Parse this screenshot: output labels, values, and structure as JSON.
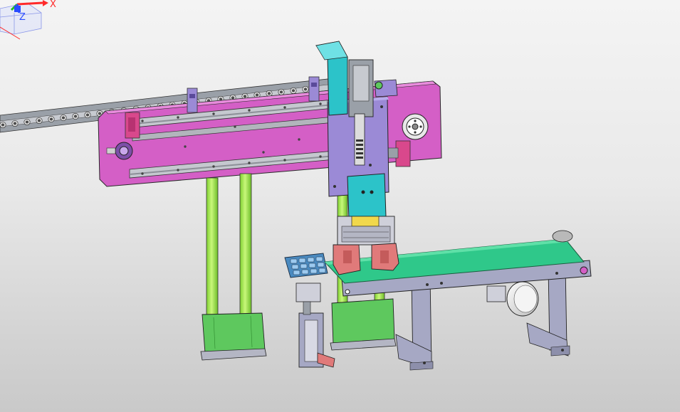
{
  "viewport": {
    "background_top": "#f4f4f4",
    "background_bottom": "#c9c9c9"
  },
  "triad": {
    "x_label": "X",
    "z_label": "Z",
    "x_color": "#ff2a2a",
    "y_color": "#22bb22",
    "z_color": "#2a4cff"
  },
  "model": {
    "parts": [
      "drag-chain",
      "gantry-beam-plate",
      "linear-rails",
      "carriage-plate",
      "vertical-actuator",
      "gripper-head",
      "support-columns",
      "column-bases",
      "tray-stand",
      "belt-conveyor",
      "conveyor-motor"
    ],
    "colors": {
      "beam": "#d45fc6",
      "carriage": "#9b8ad6",
      "actuator": "#2cc3c9",
      "columns": "#9be84a",
      "bases": "#5ec85e",
      "gripper_jaws": "#e07a7a",
      "tray": "#4a8ac0",
      "belt": "#2fc88a",
      "frame": "#a6a8c4"
    }
  }
}
